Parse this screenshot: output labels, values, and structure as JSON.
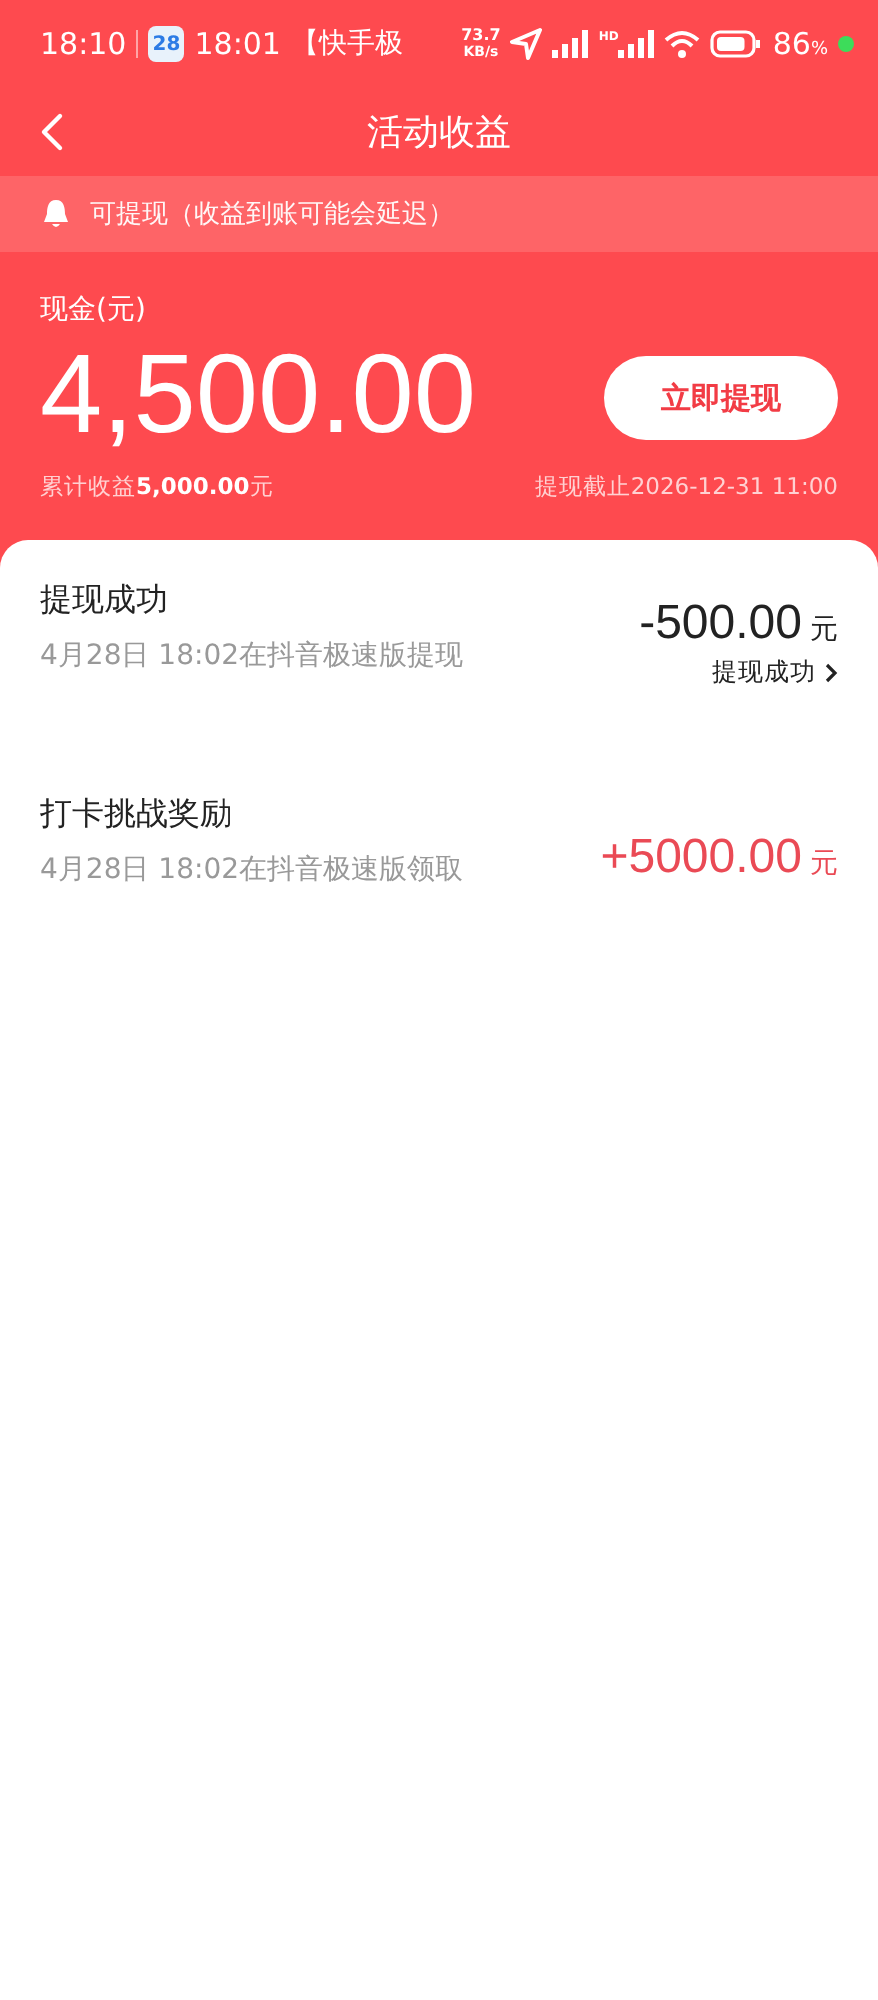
{
  "status_bar": {
    "time": "18:10",
    "calendar_day": "28",
    "notification_time": "18:01",
    "notification_text": "【快手极",
    "net_speed": "73.7",
    "net_unit": "KB/s",
    "hd_label": "HD",
    "battery": "86",
    "battery_unit": "%"
  },
  "header": {
    "title": "活动收益"
  },
  "notice": {
    "text": "可提现（收益到账可能会延迟）"
  },
  "balance": {
    "label": "现金(元)",
    "amount": "4,500.00",
    "button": "立即提现",
    "total": "累计收益**5,000.00**元",
    "deadline": "提现截止2026-12-31 11:00"
  },
  "records": [
    {
      "kind": "withdraw",
      "title": "提现成功",
      "detail": "4月28日 18:02在抖音极速版提现",
      "amount": "-500.00",
      "unit": "元",
      "status": "提现成功"
    },
    {
      "kind": "income",
      "title": "打卡挑战奖励",
      "detail": "4月28日 18:02在抖音极速版领取",
      "amount": "+5000.00",
      "unit": "元"
    }
  ]
}
